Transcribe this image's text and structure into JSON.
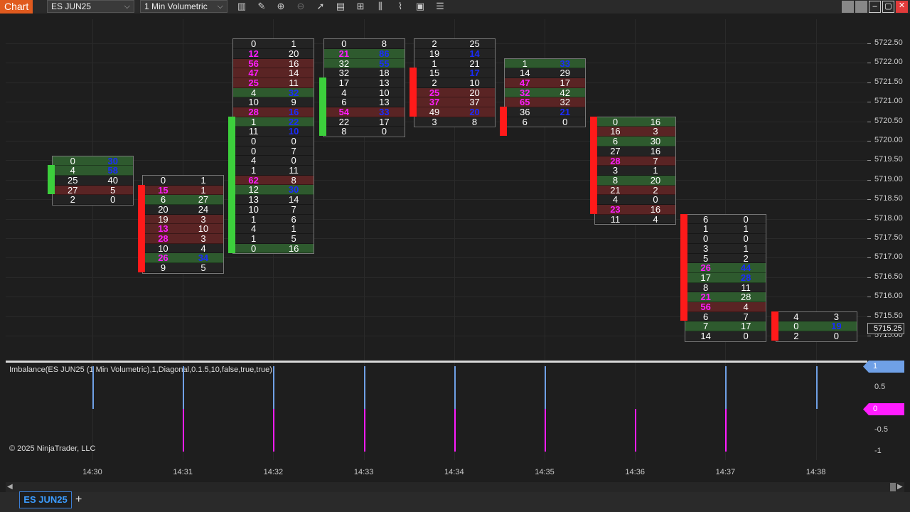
{
  "app": {
    "title": "Chart"
  },
  "toolbar": {
    "instrument": "ES JUN25",
    "bar_type": "1 Min Volumetric",
    "icons": [
      "bar-style-icon",
      "draw-tool-icon",
      "zoom-in-icon",
      "zoom-out-icon",
      "pointer-icon",
      "data-box-icon",
      "properties-icon",
      "strategies-icon",
      "indicators-icon",
      "templates-icon",
      "menu-icon"
    ]
  },
  "window_buttons": [
    "restore-icon",
    "snap-icon",
    "minimize-icon",
    "maximize-icon",
    "close-icon"
  ],
  "price_axis": {
    "labels": [
      "5722.50",
      "5722.00",
      "5721.50",
      "5721.00",
      "5720.50",
      "5720.00",
      "5719.50",
      "5719.00",
      "5718.50",
      "5718.00",
      "5717.50",
      "5717.00",
      "5716.50",
      "5716.00",
      "5715.50",
      "5715.00"
    ],
    "current_price": "5715.25"
  },
  "time_axis": {
    "labels": [
      "14:30",
      "14:31",
      "14:32",
      "14:33",
      "14:34",
      "14:35",
      "14:36",
      "14:37",
      "14:38"
    ]
  },
  "footprint_bars": [
    {
      "time": "14:30",
      "high": 5719.5,
      "low": 5718.5,
      "direction": "up",
      "bodyTop": 5719.25,
      "bodyBottom": 5718.75,
      "rows": [
        [
          "0",
          "30",
          "g",
          "",
          "b"
        ],
        [
          "4",
          "58",
          "g",
          "",
          "b"
        ],
        [
          "25",
          "40",
          "n",
          "",
          ""
        ],
        [
          "27",
          "5",
          "r",
          "",
          ""
        ],
        [
          "2",
          "0",
          "n",
          "",
          ""
        ]
      ]
    },
    {
      "time": "14:31",
      "high": 5719.0,
      "low": 5716.5,
      "direction": "down",
      "bodyTop": 5718.75,
      "bodyBottom": 5716.75,
      "rows": [
        [
          "0",
          "1",
          "n",
          "",
          ""
        ],
        [
          "15",
          "1",
          "r",
          "m",
          ""
        ],
        [
          "6",
          "27",
          "g",
          "",
          ""
        ],
        [
          "20",
          "24",
          "n",
          "",
          ""
        ],
        [
          "19",
          "3",
          "r",
          "",
          ""
        ],
        [
          "13",
          "10",
          "r",
          "m",
          ""
        ],
        [
          "28",
          "3",
          "r",
          "m",
          ""
        ],
        [
          "10",
          "4",
          "n",
          "",
          ""
        ],
        [
          "26",
          "34",
          "g",
          "m",
          "b"
        ],
        [
          "9",
          "5",
          "n",
          "",
          ""
        ]
      ]
    },
    {
      "time": "14:32",
      "high": 5722.5,
      "low": 5717.0,
      "direction": "up",
      "bodyTop": 5720.5,
      "bodyBottom": 5717.25,
      "rows": [
        [
          "0",
          "1",
          "n",
          "",
          ""
        ],
        [
          "12",
          "20",
          "n",
          "m",
          ""
        ],
        [
          "56",
          "16",
          "r",
          "m",
          ""
        ],
        [
          "47",
          "14",
          "r",
          "m",
          ""
        ],
        [
          "25",
          "11",
          "r",
          "m",
          ""
        ],
        [
          "4",
          "32",
          "g",
          "",
          "b"
        ],
        [
          "10",
          "9",
          "n",
          "",
          ""
        ],
        [
          "28",
          "16",
          "r",
          "m",
          "b"
        ],
        [
          "1",
          "22",
          "g",
          "",
          "b"
        ],
        [
          "11",
          "10",
          "n",
          "",
          "b"
        ],
        [
          "0",
          "0",
          "n",
          "",
          ""
        ],
        [
          "0",
          "7",
          "n",
          "",
          ""
        ],
        [
          "4",
          "0",
          "n",
          "",
          ""
        ],
        [
          "1",
          "11",
          "n",
          "",
          ""
        ],
        [
          "62",
          "8",
          "r",
          "m",
          ""
        ],
        [
          "12",
          "30",
          "g",
          "",
          "b"
        ],
        [
          "13",
          "14",
          "n",
          "",
          ""
        ],
        [
          "10",
          "7",
          "n",
          "",
          ""
        ],
        [
          "1",
          "6",
          "n",
          "",
          ""
        ],
        [
          "4",
          "1",
          "n",
          "",
          ""
        ],
        [
          "1",
          "5",
          "n",
          "",
          ""
        ],
        [
          "0",
          "16",
          "g",
          "",
          ""
        ]
      ]
    },
    {
      "time": "14:33",
      "high": 5722.5,
      "low": 5720.0,
      "direction": "up",
      "bodyTop": 5721.5,
      "bodyBottom": 5720.25,
      "rows": [
        [
          "0",
          "8",
          "n",
          "",
          ""
        ],
        [
          "21",
          "86",
          "g",
          "m",
          "b"
        ],
        [
          "32",
          "55",
          "g",
          "",
          "b"
        ],
        [
          "32",
          "18",
          "n",
          "",
          ""
        ],
        [
          "17",
          "13",
          "n",
          "",
          ""
        ],
        [
          "4",
          "10",
          "n",
          "",
          ""
        ],
        [
          "6",
          "13",
          "n",
          "",
          ""
        ],
        [
          "54",
          "33",
          "r",
          "m",
          "b"
        ],
        [
          "22",
          "17",
          "n",
          "",
          ""
        ],
        [
          "8",
          "0",
          "n",
          "",
          ""
        ]
      ]
    },
    {
      "time": "14:34",
      "high": 5722.5,
      "low": 5720.5,
      "direction": "down",
      "bodyTop": 5721.75,
      "bodyBottom": 5720.75,
      "rows": [
        [
          "2",
          "25",
          "n",
          "",
          ""
        ],
        [
          "19",
          "14",
          "n",
          "",
          "b"
        ],
        [
          "1",
          "21",
          "n",
          "",
          ""
        ],
        [
          "15",
          "17",
          "n",
          "",
          "b"
        ],
        [
          "2",
          "10",
          "n",
          "",
          ""
        ],
        [
          "25",
          "20",
          "r",
          "m",
          ""
        ],
        [
          "37",
          "37",
          "r",
          "m",
          ""
        ],
        [
          "49",
          "20",
          "r",
          "",
          "b"
        ],
        [
          "3",
          "8",
          "n",
          "",
          ""
        ]
      ]
    },
    {
      "time": "14:35",
      "high": 5722.0,
      "low": 5720.5,
      "direction": "down",
      "bodyTop": 5720.75,
      "bodyBottom": 5720.25,
      "rows": [
        [
          "1",
          "33",
          "g",
          "",
          "b"
        ],
        [
          "14",
          "29",
          "n",
          "",
          ""
        ],
        [
          "47",
          "17",
          "r",
          "m",
          ""
        ],
        [
          "32",
          "42",
          "g",
          "m",
          ""
        ],
        [
          "65",
          "32",
          "r",
          "m",
          ""
        ],
        [
          "36",
          "21",
          "n",
          "",
          "b"
        ],
        [
          "6",
          "0",
          "n",
          "",
          ""
        ]
      ]
    },
    {
      "time": "14:36",
      "high": 5720.5,
      "low": 5718.0,
      "direction": "down",
      "bodyTop": 5720.5,
      "bodyBottom": 5718.25,
      "rows": [
        [
          "0",
          "16",
          "g",
          "",
          ""
        ],
        [
          "16",
          "3",
          "r",
          "",
          ""
        ],
        [
          "6",
          "30",
          "g",
          "",
          ""
        ],
        [
          "27",
          "16",
          "n",
          "",
          ""
        ],
        [
          "28",
          "7",
          "r",
          "m",
          ""
        ],
        [
          "3",
          "1",
          "n",
          "",
          ""
        ],
        [
          "8",
          "20",
          "g",
          "",
          ""
        ],
        [
          "21",
          "2",
          "r",
          "",
          ""
        ],
        [
          "4",
          "0",
          "n",
          "",
          ""
        ],
        [
          "23",
          "16",
          "r",
          "m",
          ""
        ],
        [
          "11",
          "4",
          "n",
          "",
          ""
        ]
      ]
    },
    {
      "time": "14:37",
      "high": 5718.0,
      "low": 5715.0,
      "direction": "down",
      "bodyTop": 5718.0,
      "bodyBottom": 5715.5,
      "rows": [
        [
          "6",
          "0",
          "n",
          "",
          ""
        ],
        [
          "1",
          "1",
          "n",
          "",
          ""
        ],
        [
          "0",
          "0",
          "n",
          "",
          ""
        ],
        [
          "3",
          "1",
          "n",
          "",
          ""
        ],
        [
          "5",
          "2",
          "n",
          "",
          ""
        ],
        [
          "26",
          "44",
          "g",
          "m",
          "b"
        ],
        [
          "17",
          "28",
          "g",
          "",
          "b"
        ],
        [
          "8",
          "11",
          "n",
          "",
          ""
        ],
        [
          "21",
          "28",
          "g",
          "m",
          ""
        ],
        [
          "56",
          "4",
          "r",
          "m",
          ""
        ],
        [
          "6",
          "7",
          "n",
          "",
          ""
        ],
        [
          "7",
          "17",
          "g",
          "",
          ""
        ],
        [
          "14",
          "0",
          "n",
          "",
          ""
        ]
      ]
    },
    {
      "time": "14:38",
      "high": 5715.5,
      "low": 5715.0,
      "direction": "down",
      "bodyTop": 5715.5,
      "bodyBottom": 5715.0,
      "rows": [
        [
          "4",
          "3",
          "n",
          "",
          ""
        ],
        [
          "0",
          "19",
          "g",
          "",
          "b"
        ],
        [
          "2",
          "0",
          "n",
          "",
          ""
        ]
      ]
    }
  ],
  "indicator": {
    "label": "Imbalance(ES JUN25 (1 Min Volumetric),1,Diagonal,0.1.5,10,false,true,true)",
    "axis_labels": [
      "1",
      "0.5",
      "-0.5",
      "-1"
    ],
    "flag_values": [
      "1",
      "0"
    ],
    "flag_colors": {
      "pos": "#6fa0e6",
      "neg": "#ff1cff"
    },
    "buy_imbalance": [
      1,
      1,
      1,
      1,
      1,
      1,
      0,
      1,
      1
    ],
    "sell_imbalance": [
      0,
      -1,
      -1,
      -1,
      -1,
      -1,
      -1,
      -1,
      0
    ]
  },
  "copyright": "© 2025 NinjaTrader, LLC",
  "tabs": {
    "active": "ES JUN25",
    "add": "+"
  }
}
